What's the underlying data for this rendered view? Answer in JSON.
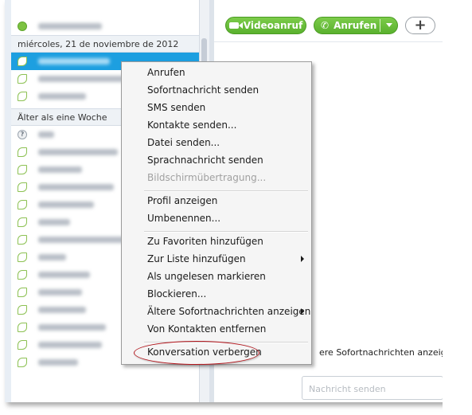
{
  "contacts": {
    "date_header": "miércoles, 21 de noviembre de 2012",
    "older_header": "Älter als eine Woche",
    "rows_top": [
      {
        "status": "online",
        "w": 80
      }
    ],
    "rows_recent": [
      {
        "status": "leaf",
        "w": 90,
        "selected": true
      },
      {
        "status": "leaf",
        "w": 110
      },
      {
        "status": "leaf",
        "w": 60
      }
    ],
    "rows_older": [
      {
        "status": "unknown",
        "w": 20
      },
      {
        "status": "leaf",
        "w": 100
      },
      {
        "status": "leaf",
        "w": 55
      },
      {
        "status": "leaf",
        "w": 95
      },
      {
        "status": "leaf",
        "w": 70
      },
      {
        "status": "leaf",
        "w": 40
      },
      {
        "status": "leaf",
        "w": 115
      },
      {
        "status": "leaf",
        "w": 35
      },
      {
        "status": "leaf",
        "w": 65
      },
      {
        "status": "leaf",
        "w": 55
      },
      {
        "status": "leaf",
        "w": 60
      },
      {
        "status": "leaf",
        "w": 85
      },
      {
        "status": "leaf",
        "w": 80
      },
      {
        "status": "leaf",
        "w": 50
      }
    ]
  },
  "toolbar": {
    "video_label": "Videoanruf",
    "call_label": "Anrufen",
    "add_label": "+"
  },
  "chat": {
    "older_messages_label": "ere Sofortnachrichten anzeigen: G",
    "input_placeholder": "Nachricht senden"
  },
  "context_menu": {
    "group1": [
      {
        "label": "Anrufen"
      },
      {
        "label": "Sofortnachricht senden"
      },
      {
        "label": "SMS senden"
      },
      {
        "label": "Kontakte senden..."
      },
      {
        "label": "Datei senden..."
      },
      {
        "label": "Sprachnachricht senden"
      },
      {
        "label": "Bildschirmübertragung...",
        "disabled": true
      }
    ],
    "group2": [
      {
        "label": "Profil anzeigen"
      },
      {
        "label": "Umbenennen..."
      }
    ],
    "group3": [
      {
        "label": "Zu Favoriten hinzufügen"
      },
      {
        "label": "Zur Liste hinzufügen",
        "submenu": true
      },
      {
        "label": "Als ungelesen markieren"
      },
      {
        "label": "Blockieren..."
      },
      {
        "label": "Ältere Sofortnachrichten anzeigen",
        "submenu": true
      },
      {
        "label": "Von Kontakten entfernen"
      }
    ],
    "group4": [
      {
        "label": "Konversation verbergen",
        "highlighted": true
      }
    ]
  },
  "colors": {
    "selected_row": "#1d9fe0",
    "call_green": "#5ab12e",
    "highlight_ring": "#b2161d"
  }
}
